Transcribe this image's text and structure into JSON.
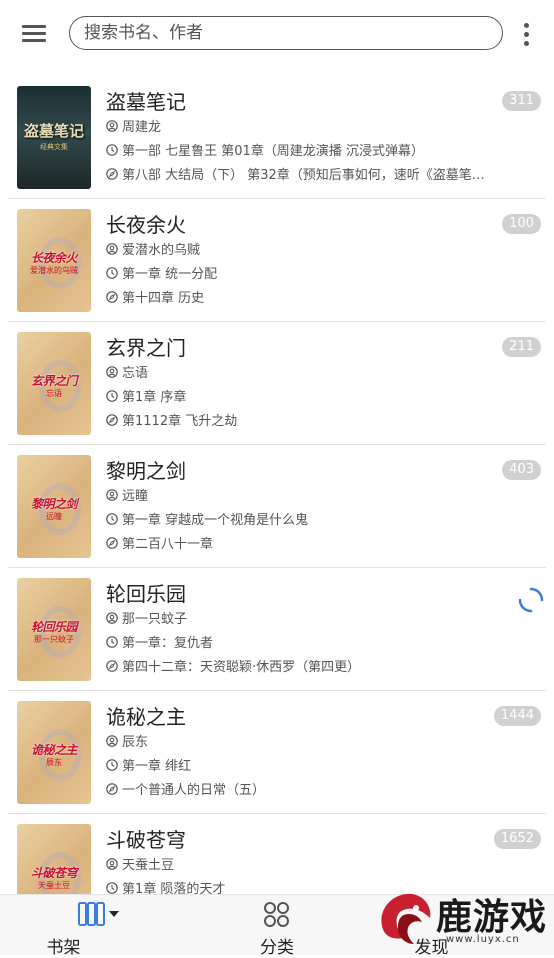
{
  "search": {
    "placeholder": "搜索书名、作者"
  },
  "books": [
    {
      "title": "盗墓笔记",
      "author": "周建龙",
      "last_read": "第一部 七星鲁王 第01章（周建龙演播 沉浸式弹幕）",
      "latest": "第八部 大结局（下） 第32章（预知后事如何，速听《盗墓笔…",
      "unread": "311",
      "cover_text": "盗墓笔记",
      "cover_sub": "经典文集"
    },
    {
      "title": "长夜余火",
      "author": "爱潜水的乌贼",
      "last_read": "第一章 统一分配",
      "latest": "第十四章 历史",
      "unread": "100",
      "cover_text": "长夜余火",
      "cover_sub": "爱潜水的乌贼"
    },
    {
      "title": "玄界之门",
      "author": "忘语",
      "last_read": "第1章 序章",
      "latest": "第1112章 飞升之劫",
      "unread": "211",
      "cover_text": "玄界之门",
      "cover_sub": "忘语"
    },
    {
      "title": "黎明之剑",
      "author": "远瞳",
      "last_read": "第一章 穿越成一个视角是什么鬼",
      "latest": "第二百八十一章",
      "unread": "403",
      "cover_text": "黎明之剑",
      "cover_sub": "远瞳"
    },
    {
      "title": "轮回乐园",
      "author": "那一只蚊子",
      "last_read": "第一章：复仇者",
      "latest": "第四十二章：天资聪颖·休西罗（第四更）",
      "unread": "",
      "cover_text": "轮回乐园",
      "cover_sub": "那一只蚊子"
    },
    {
      "title": "诡秘之主",
      "author": "辰东",
      "last_read": "第一章 绯红",
      "latest": "一个普通人的日常（五）",
      "unread": "1444",
      "cover_text": "诡秘之主",
      "cover_sub": "辰东"
    },
    {
      "title": "斗破苍穹",
      "author": "天蚕土豆",
      "last_read": "第1章 陨落的天才",
      "latest": "",
      "unread": "1652",
      "cover_text": "斗破苍穹",
      "cover_sub": "天蚕土豆"
    }
  ],
  "nav": {
    "shelf": "书架",
    "category": "分类",
    "discover": "发现"
  },
  "watermark": {
    "name": "鹿游戏",
    "url": "www.luyx.cn"
  },
  "colors": {
    "accent": "#3b7ddd",
    "badge": "#d0d0d0",
    "cover_red": "#c8102e"
  }
}
